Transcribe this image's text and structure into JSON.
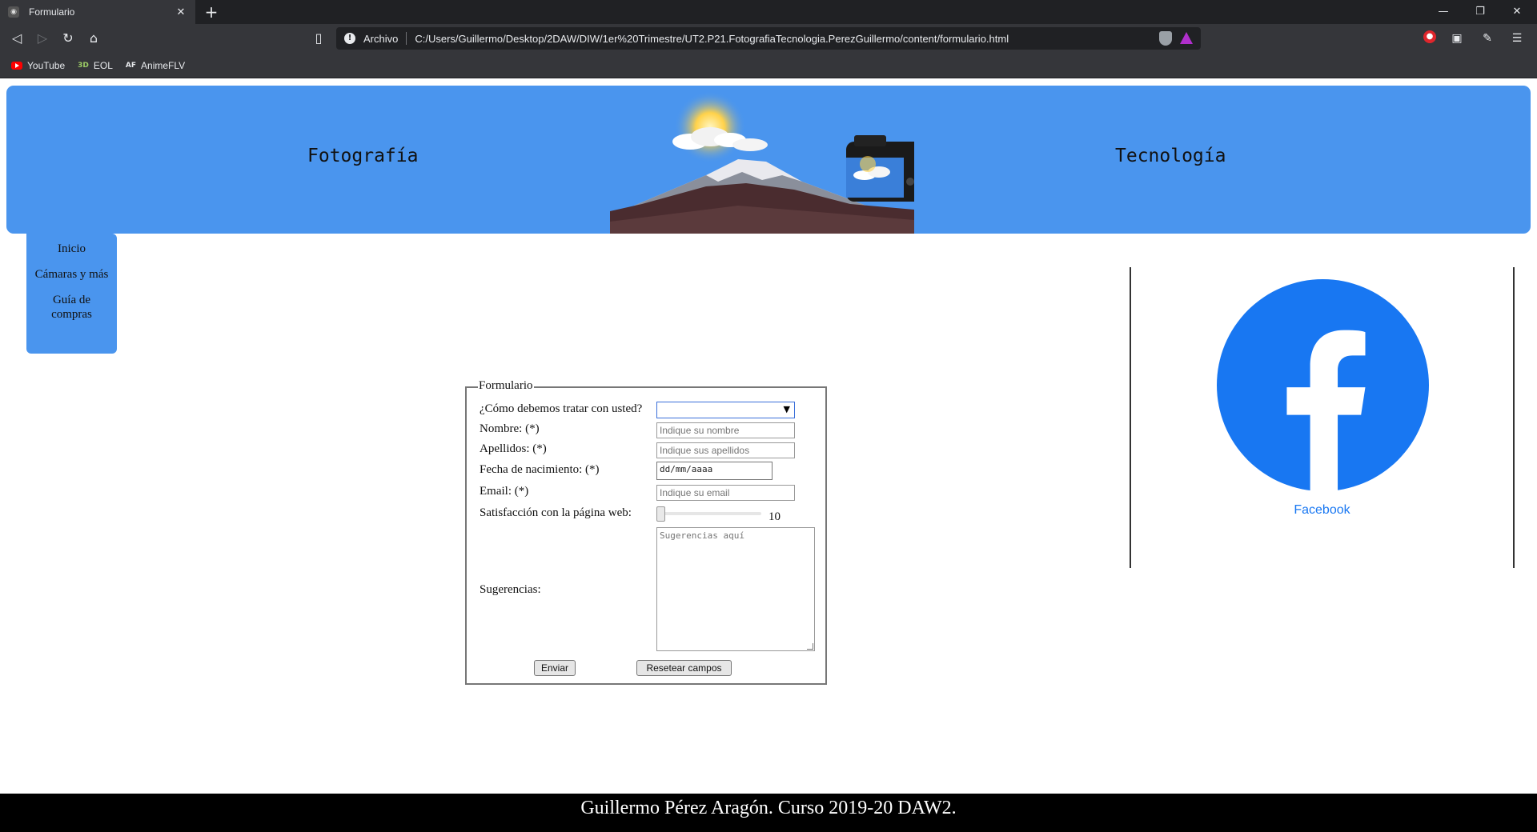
{
  "browser": {
    "tab_title": "Formulario",
    "scheme_label": "Archivo",
    "url": "C:/Users/Guillermo/Desktop/2DAW/DIW/1er%20Trimestre/UT2.P21.FotografiaTecnologia.PerezGuillermo/content/formulario.html",
    "bookmarks": [
      {
        "label": "YouTube",
        "icon": "youtube-icon"
      },
      {
        "label": "EOL",
        "icon": "eol-icon",
        "icon_text": "3D"
      },
      {
        "label": "AnimeFLV",
        "icon": "animeflv-icon",
        "icon_text": "AF"
      }
    ],
    "badge_count": "1"
  },
  "header": {
    "left_title": "Fotografía",
    "right_title": "Tecnología"
  },
  "sidenav": {
    "items": [
      "Inicio",
      "Cámaras y más",
      "Guía de compras"
    ]
  },
  "aside": {
    "facebook_label": "Facebook",
    "facebook_color": "#1877f2"
  },
  "form": {
    "legend": "Formulario",
    "treatment_label": "¿Cómo debemos tratar con usted?",
    "treatment_value": "",
    "name_label": "Nombre: (*)",
    "name_placeholder": "Indique su nombre",
    "surname_label": "Apellidos: (*)",
    "surname_placeholder": "Indique sus apellidos",
    "birth_label": "Fecha de nacimiento: (*)",
    "birth_placeholder": "dd/mm/aaaa",
    "email_label": "Email: (*)",
    "email_placeholder": "Indique su email",
    "satisfaction_label": "Satisfacción con la página web:",
    "satisfaction_value": "10",
    "suggestions_label": "Sugerencias:",
    "suggestions_placeholder": "Sugerencias aquí",
    "submit_label": "Enviar",
    "reset_label": "Resetear campos"
  },
  "footer": {
    "text": "Guillermo Pérez Aragón. Curso 2019-20 DAW2."
  },
  "colors": {
    "header_blue": "#4a95ee",
    "chrome_dark": "#202124",
    "chrome_mid": "#35363a"
  }
}
